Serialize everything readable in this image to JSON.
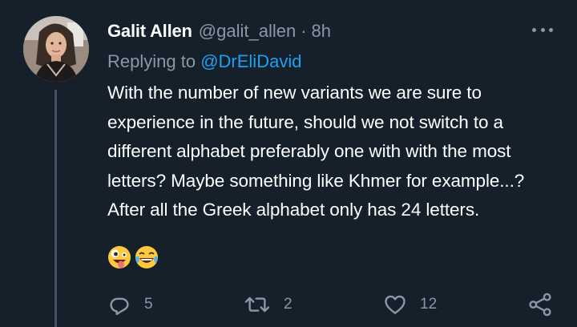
{
  "tweet": {
    "display_name": "Galit Allen",
    "handle": "@galit_allen",
    "separator": "·",
    "time": "8h",
    "replying_prefix": "Replying to",
    "replying_to": "@DrEliDavid",
    "text": "With the number of new variants we are sure to experience in the future, should we not switch to a different alphabet preferably one with with the most letters? Maybe something like Khmer for example...? After all the Greek alphabet only has 24 letters.",
    "emojis": [
      "zany-face",
      "tears-of-joy"
    ]
  },
  "actions": {
    "reply_count": "5",
    "retweet_count": "2",
    "like_count": "12"
  },
  "colors": {
    "background": "#15202b",
    "primary_text": "#ffffff",
    "secondary_text": "#8899a6",
    "link": "#1da1f2",
    "thread_line": "#3d5466"
  },
  "icons": {
    "reply": "reply-icon",
    "retweet": "retweet-icon",
    "like": "heart-icon",
    "share": "share-icon",
    "more": "more-options-icon"
  }
}
